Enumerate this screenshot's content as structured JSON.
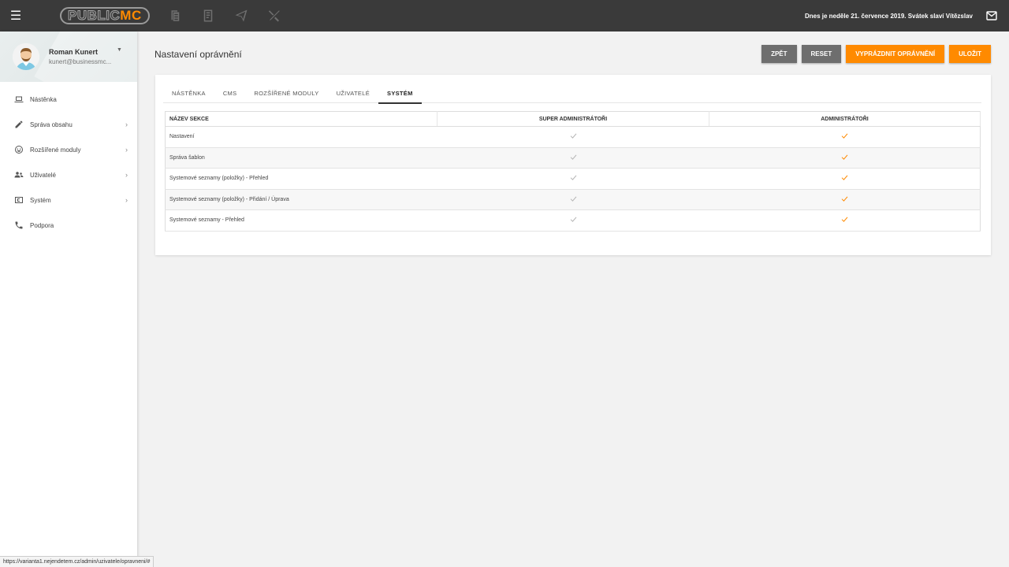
{
  "topbar": {
    "logo_left": "PUBLIC",
    "logo_right": "MC",
    "date_text": "Dnes je neděle 21. července 2019. Svátek slaví Vítězslav",
    "icons": [
      "pages-icon",
      "document-icon",
      "send-icon",
      "tools-icon",
      "mail-icon"
    ]
  },
  "user": {
    "name": "Roman Kunert",
    "email": "kunert@businessmc..."
  },
  "nav": {
    "items": [
      {
        "label": "Nástěnka",
        "icon": "laptop-icon",
        "has_children": false
      },
      {
        "label": "Správa obsahu",
        "icon": "pencil-icon",
        "has_children": true
      },
      {
        "label": "Rozšířené moduly",
        "icon": "smiley-icon",
        "has_children": true
      },
      {
        "label": "Uživatelé",
        "icon": "users-icon",
        "has_children": true
      },
      {
        "label": "Systém",
        "icon": "system-icon",
        "has_children": true
      },
      {
        "label": "Podpora",
        "icon": "phone-icon",
        "has_children": false
      }
    ]
  },
  "page": {
    "title": "Nastavení oprávnění"
  },
  "actions": {
    "back": "ZPĚT",
    "reset": "RESET",
    "clear": "VYPRÁZDNIT OPRÁVNĚNÍ",
    "save": "ULOŽIT"
  },
  "tabs": [
    {
      "label": "NÁSTĚNKA",
      "active": false
    },
    {
      "label": "CMS",
      "active": false
    },
    {
      "label": "ROZŠÍŘENÉ MODULY",
      "active": false
    },
    {
      "label": "UŽIVATELÉ",
      "active": false
    },
    {
      "label": "SYSTÉM",
      "active": true
    }
  ],
  "table": {
    "headers": [
      "NÁZEV SEKCE",
      "SUPER ADMINISTRÁTOŘI",
      "ADMINISTRÁTOŘI"
    ],
    "rows": [
      {
        "name": "Nastavení",
        "super_admin": true,
        "admin": true
      },
      {
        "name": "Správa šablon",
        "super_admin": true,
        "admin": true
      },
      {
        "name": "Systemové seznamy (položky) - Přehled",
        "super_admin": true,
        "admin": true
      },
      {
        "name": "Systemové seznamy (položky) - Přidání / Úprava",
        "super_admin": true,
        "admin": true
      },
      {
        "name": "Systemové seznamy - Přehled",
        "super_admin": true,
        "admin": true
      }
    ]
  },
  "status_url": "https://varianta1.nejendetem.cz/admin/uzivatele/opravneni/#",
  "colors": {
    "accent": "#ff8a00",
    "topbar": "#3a3a3a",
    "button_gray": "#6e6e6e"
  }
}
